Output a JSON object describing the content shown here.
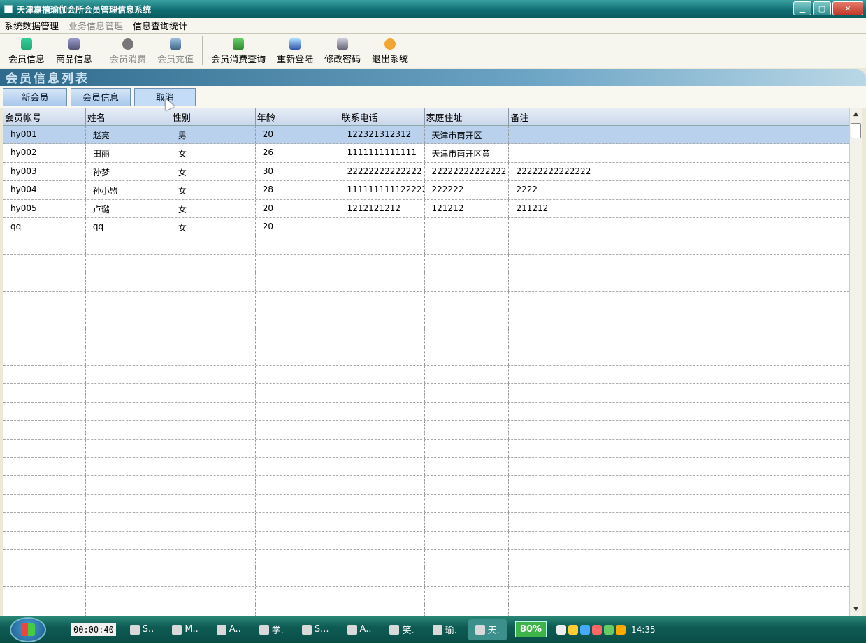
{
  "window": {
    "title": "天津嘉禧瑜伽会所会员管理信息系统"
  },
  "menu": [
    {
      "label": "系统数据管理",
      "disabled": false
    },
    {
      "label": "业务信息管理",
      "disabled": true
    },
    {
      "label": "信息查询统计",
      "disabled": false
    }
  ],
  "toolbar": {
    "member_info": "会员信息",
    "goods_info": "商品信息",
    "member_consume": "会员消费",
    "member_recharge": "会员充值",
    "consume_query": "会员消费查询",
    "relogin": "重新登陆",
    "change_password": "修改密码",
    "exit_system": "退出系统"
  },
  "section": {
    "title": "会员信息列表"
  },
  "actions": {
    "new_member": "新会员",
    "member_info": "会员信息",
    "cancel": "取消"
  },
  "grid": {
    "columns": [
      "会员帐号",
      "姓名",
      "性别",
      "年龄",
      "联系电话",
      "家庭住址",
      "备注"
    ],
    "rows": [
      [
        "hy001",
        "赵亮",
        "男",
        "20",
        "122321312312",
        "天津市南开区",
        ""
      ],
      [
        "hy002",
        "田丽",
        "女",
        "26",
        "1111111111111",
        "天津市南开区黄",
        ""
      ],
      [
        "hy003",
        "孙梦",
        "女",
        "30",
        "22222222222222",
        "22222222222222",
        "22222222222222"
      ],
      [
        "hy004",
        "孙小盟",
        "女",
        "28",
        "111111111122222",
        "222222",
        "2222"
      ],
      [
        "hy005",
        "卢璐",
        "女",
        "20",
        "1212121212",
        "121212",
        "211212"
      ],
      [
        "qq",
        "qq",
        "女",
        "20",
        "",
        "",
        ""
      ]
    ],
    "empty_rows": 21
  },
  "taskbar": {
    "timer": "00:00:40",
    "tasks": [
      "S..",
      "M..",
      "A..",
      "学.",
      "S...",
      "A..",
      "笑.",
      "瑜.",
      "天."
    ],
    "battery": "80%",
    "clock": "14:35"
  }
}
